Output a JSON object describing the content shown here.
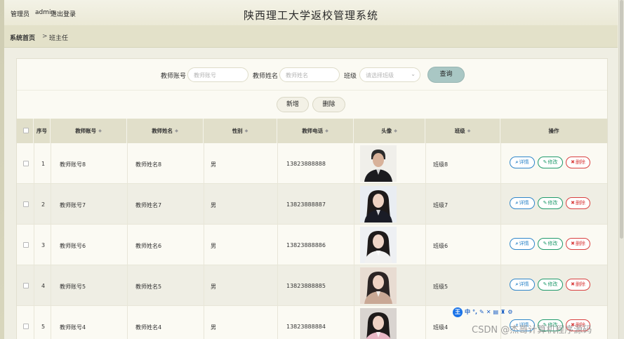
{
  "header": {
    "user_role": "管理员",
    "username": "admin",
    "logout_label": "退出登录",
    "app_title": "陕西理工大学返校管理系统"
  },
  "breadcrumb": {
    "home": "系统首页",
    "separator": ">",
    "current": "班主任"
  },
  "search": {
    "teacher_id_label": "教师账号",
    "teacher_id_placeholder": "教师账号",
    "teacher_name_label": "教师姓名",
    "teacher_name_placeholder": "教师姓名",
    "class_label": "班级",
    "class_placeholder": "请选择班级",
    "query_button": "查询"
  },
  "actions": {
    "add_button": "新增",
    "delete_button": "删除"
  },
  "table": {
    "columns": {
      "seq": "序号",
      "account": "教师账号",
      "name": "教师姓名",
      "gender": "性别",
      "phone": "教师电话",
      "avatar": "头像",
      "class": "班级",
      "ops": "操作"
    },
    "row_actions": {
      "view": "详情",
      "edit": "修改",
      "delete": "删除"
    },
    "rows": [
      {
        "seq": "1",
        "account": "教师账号8",
        "name": "教师姓名8",
        "gender": "男",
        "phone": "13823888888",
        "class": "班级8"
      },
      {
        "seq": "2",
        "account": "教师账号7",
        "name": "教师姓名7",
        "gender": "男",
        "phone": "13823888887",
        "class": "班级7"
      },
      {
        "seq": "3",
        "account": "教师账号6",
        "name": "教师姓名6",
        "gender": "男",
        "phone": "13823888886",
        "class": "班级6"
      },
      {
        "seq": "4",
        "account": "教师账号5",
        "name": "教师姓名5",
        "gender": "男",
        "phone": "13823888885",
        "class": "班级5"
      },
      {
        "seq": "5",
        "account": "教师账号4",
        "name": "教师姓名4",
        "gender": "男",
        "phone": "13823888884",
        "class": "班级4"
      }
    ]
  },
  "ime_toolbar": {
    "logo": "王",
    "mode": "中"
  },
  "watermark": "CSDN @杰哥计算机程序源码",
  "colors": {
    "header_bg": "#efeee3",
    "table_head_bg": "#e1dfca",
    "query_button": "#a9c7c4",
    "view": "#2f86c9",
    "edit": "#1f9a6b",
    "delete": "#d94040"
  }
}
